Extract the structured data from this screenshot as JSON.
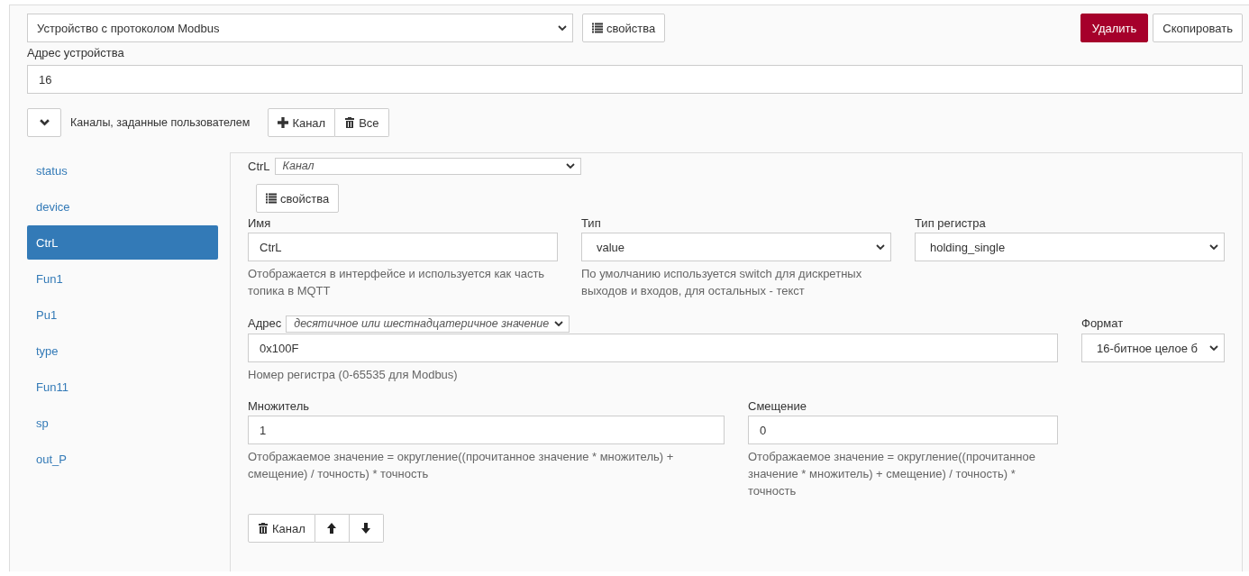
{
  "device": {
    "protocol_select": "Устройство с протоколом Modbus",
    "properties_button": "свойства",
    "delete_button": "Удалить",
    "copy_button": "Скопировать",
    "address_label": "Адрес устройства",
    "address_value": "16"
  },
  "channels_section": {
    "expanded": true,
    "title": "Каналы, заданные пользователем",
    "add_button": "Канал",
    "delete_all_button": "Все"
  },
  "channel_list": [
    {
      "label": "status",
      "selected": false
    },
    {
      "label": "device",
      "selected": false
    },
    {
      "label": "CtrL",
      "selected": true
    },
    {
      "label": "Fun1",
      "selected": false
    },
    {
      "label": "Pu1",
      "selected": false
    },
    {
      "label": "type",
      "selected": false
    },
    {
      "label": "Fun11",
      "selected": false
    },
    {
      "label": "sp",
      "selected": false
    },
    {
      "label": "out_P",
      "selected": false
    }
  ],
  "channel_editor": {
    "title": "CtrL",
    "type_select": "Канал",
    "properties_button": "свойства",
    "name": {
      "label": "Имя",
      "value": "CtrL",
      "help": "Отображается в интерфейсе и используется как часть топика в MQTT"
    },
    "type": {
      "label": "Тип",
      "value": "value",
      "help": "По умолчанию используется switch для дискретных выходов и входов, для остальных - текст"
    },
    "register_type": {
      "label": "Тип регистра",
      "value": "holding_single"
    },
    "address": {
      "label": "Адрес",
      "mode_select": "десятичное или шестнадцатеричное значение",
      "value": "0x100F",
      "help": "Номер регистра (0-65535 для Modbus)"
    },
    "format": {
      "label": "Формат",
      "value": "16-битное целое б"
    },
    "multiplier": {
      "label": "Множитель",
      "value": "1",
      "help": "Отображаемое значение = округление((прочитанное значение * множитель) + смещение) / точность) * точность"
    },
    "offset": {
      "label": "Смещение",
      "value": "0",
      "help": "Отображаемое значение = округление((прочитанное значение * множитель) + смещение) / точность) * точность"
    },
    "delete_button": "Канал"
  }
}
